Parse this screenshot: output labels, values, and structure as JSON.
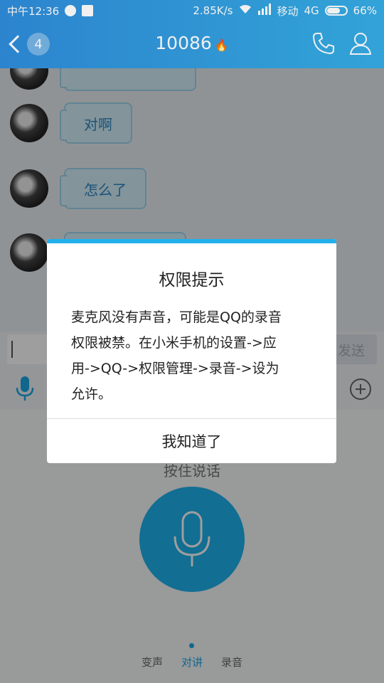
{
  "status_bar": {
    "time": "中午12:36",
    "net_speed": "2.85K/s",
    "carrier": "移动",
    "network": "4G",
    "battery": "66%",
    "battery_level": 0.66
  },
  "header": {
    "unread_badge": "4",
    "title": "10086"
  },
  "chat": {
    "messages": [
      {
        "text": "对啊"
      },
      {
        "text": "怎么了"
      }
    ]
  },
  "input": {
    "send_label": "发送"
  },
  "voice_panel": {
    "hold_to_talk": "按住说话",
    "tabs": [
      "变声",
      "对讲",
      "录音"
    ],
    "active_tab": "对讲"
  },
  "dialog": {
    "title": "权限提示",
    "body_lines": [
      "麦克风没有声音，可能是QQ的录音",
      "权限被禁。在小米手机的设置->应",
      "用->QQ->权限管理->录音->设为",
      "允许。"
    ],
    "button": "我知道了"
  },
  "colors": {
    "header_start": "#2f8ddb",
    "header_end": "#36aee6",
    "accent": "#22b0ec"
  }
}
